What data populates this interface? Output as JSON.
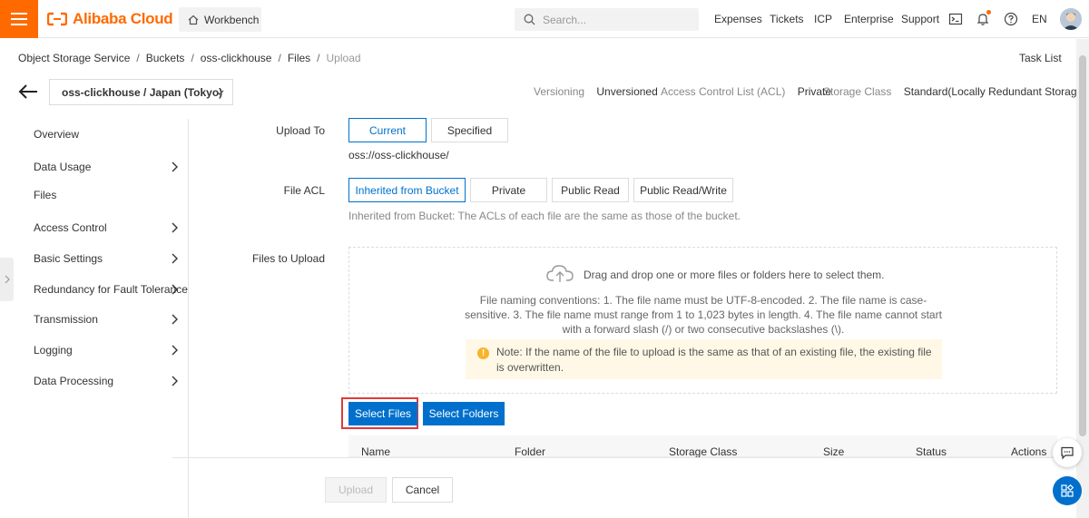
{
  "topbar": {
    "brand": "Alibaba Cloud",
    "workbench_label": "Workbench",
    "search_placeholder": "Search...",
    "nav": [
      "Expenses",
      "Tickets",
      "ICP",
      "Enterprise",
      "Support"
    ],
    "language": "EN",
    "brand_color": "#ff6a00"
  },
  "breadcrumb": [
    "Object Storage Service",
    "Buckets",
    "oss-clickhouse",
    "Files",
    "Upload"
  ],
  "task_list_label": "Task List",
  "bucket": {
    "selector_value": "oss-clickhouse / Japan (Tokyo)",
    "versioning_label": "Versioning",
    "versioning_value": "Unversioned",
    "acl_label": "Access Control List (ACL)",
    "acl_value": "Private",
    "storage_label": "Storage Class",
    "storage_value": "Standard(Locally Redundant Storage)"
  },
  "sidebar": {
    "items": [
      {
        "label": "Overview",
        "has_chevron": false
      },
      {
        "label": "Data Usage",
        "has_chevron": true
      },
      {
        "label": "Files",
        "has_chevron": false
      },
      {
        "label": "Access Control",
        "has_chevron": true
      },
      {
        "label": "Basic Settings",
        "has_chevron": true
      },
      {
        "label": "Redundancy for Fault Tolerance",
        "has_chevron": true
      },
      {
        "label": "Transmission",
        "has_chevron": true
      },
      {
        "label": "Logging",
        "has_chevron": true
      },
      {
        "label": "Data Processing",
        "has_chevron": true
      }
    ]
  },
  "form": {
    "upload_to_label": "Upload To",
    "upload_to_options": [
      "Current",
      "Specified"
    ],
    "upload_to_selected": "Current",
    "upload_path": "oss://oss-clickhouse/",
    "file_acl_label": "File ACL",
    "file_acl_options": [
      "Inherited from Bucket",
      "Private",
      "Public Read",
      "Public Read/Write"
    ],
    "file_acl_selected": "Inherited from Bucket",
    "file_acl_hint": "Inherited from Bucket: The ACLs of each file are the same as those of the bucket.",
    "files_to_upload_label": "Files to Upload",
    "drop_title": "Drag and drop one or more files or folders here to select them.",
    "naming_rules": "File naming conventions: 1. The file name must be UTF-8-encoded. 2. The file name is case-sensitive. 3. The file name must range from 1 to 1,023 bytes in length. 4. The file name cannot start with a forward slash (/) or two consecutive backslashes (\\).",
    "note": "Note: If the name of the file to upload is the same as that of an existing file, the existing file is overwritten.",
    "select_files_label": "Select Files",
    "select_folders_label": "Select Folders"
  },
  "table": {
    "columns": [
      "Name",
      "Folder",
      "Storage Class",
      "Size",
      "Status",
      "Actions"
    ]
  },
  "footer": {
    "upload_label": "Upload",
    "cancel_label": "Cancel"
  },
  "colors": {
    "accent": "#0070cc",
    "highlight": "#e03a3a",
    "note_bg": "#fff8e6"
  }
}
